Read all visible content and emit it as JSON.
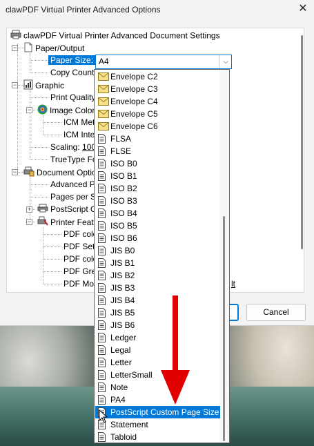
{
  "window": {
    "title": "clawPDF Virtual Printer Advanced Options",
    "close_glyph": "✕"
  },
  "tree": {
    "root": "clawPDF Virtual Printer Advanced Document Settings",
    "paper_output": "Paper/Output",
    "paper_size_label": "Paper Size:",
    "copy_count": "Copy Count",
    "graphic": "Graphic",
    "print_quality": "Print Quality",
    "image_color": "Image Color",
    "icm_method": "ICM Met",
    "icm_intent": "ICM Inte",
    "scaling_label": "Scaling:",
    "scaling_value": "100",
    "truetype": "TrueType Fo",
    "document_options": "Document Optio",
    "advanced": "Advanced P",
    "pages_per_sheet": "Pages per Sh",
    "postscript": "PostScript O",
    "printer_features": "Printer Featu",
    "pdf_color1": "PDF colo",
    "pdf_settings": "PDF Setti",
    "pdf_color2": "PDF colo",
    "pdf_grey": "PDF Grey",
    "pdf_mode": "PDF Mo",
    "pdf_mode_suffix": "lt"
  },
  "combo": {
    "value": "A4",
    "arrow": "⌵"
  },
  "dropdown": {
    "items": [
      {
        "label": "Envelope C2",
        "icon": "envelope-icon"
      },
      {
        "label": "Envelope C3",
        "icon": "envelope-icon"
      },
      {
        "label": "Envelope C4",
        "icon": "envelope-icon"
      },
      {
        "label": "Envelope C5",
        "icon": "envelope-icon"
      },
      {
        "label": "Envelope C6",
        "icon": "envelope-icon"
      },
      {
        "label": "FLSA",
        "icon": "page-icon"
      },
      {
        "label": "FLSE",
        "icon": "page-icon"
      },
      {
        "label": "ISO B0",
        "icon": "page-icon"
      },
      {
        "label": "ISO B1",
        "icon": "page-icon"
      },
      {
        "label": "ISO B2",
        "icon": "page-icon"
      },
      {
        "label": "ISO B3",
        "icon": "page-icon"
      },
      {
        "label": "ISO B4",
        "icon": "page-icon"
      },
      {
        "label": "ISO B5",
        "icon": "page-icon"
      },
      {
        "label": "ISO B6",
        "icon": "page-icon"
      },
      {
        "label": "JIS B0",
        "icon": "page-icon"
      },
      {
        "label": "JIS B1",
        "icon": "page-icon"
      },
      {
        "label": "JIS B2",
        "icon": "page-icon"
      },
      {
        "label": "JIS B3",
        "icon": "page-icon"
      },
      {
        "label": "JIS B4",
        "icon": "page-icon"
      },
      {
        "label": "JIS B5",
        "icon": "page-icon"
      },
      {
        "label": "JIS B6",
        "icon": "page-icon"
      },
      {
        "label": "Ledger",
        "icon": "page-icon"
      },
      {
        "label": "Legal",
        "icon": "page-icon"
      },
      {
        "label": "Letter",
        "icon": "page-icon"
      },
      {
        "label": "LetterSmall",
        "icon": "page-icon"
      },
      {
        "label": "Note",
        "icon": "page-icon"
      },
      {
        "label": "PA4",
        "icon": "page-icon"
      },
      {
        "label": "PostScript Custom Page Size",
        "icon": "page-icon",
        "highlighted": true
      },
      {
        "label": "Statement",
        "icon": "page-icon"
      },
      {
        "label": "Tabloid",
        "icon": "page-icon"
      }
    ]
  },
  "buttons": {
    "ok": "",
    "cancel": "Cancel"
  },
  "colors": {
    "accent": "#0078d7",
    "annotation_arrow": "#e00000"
  }
}
